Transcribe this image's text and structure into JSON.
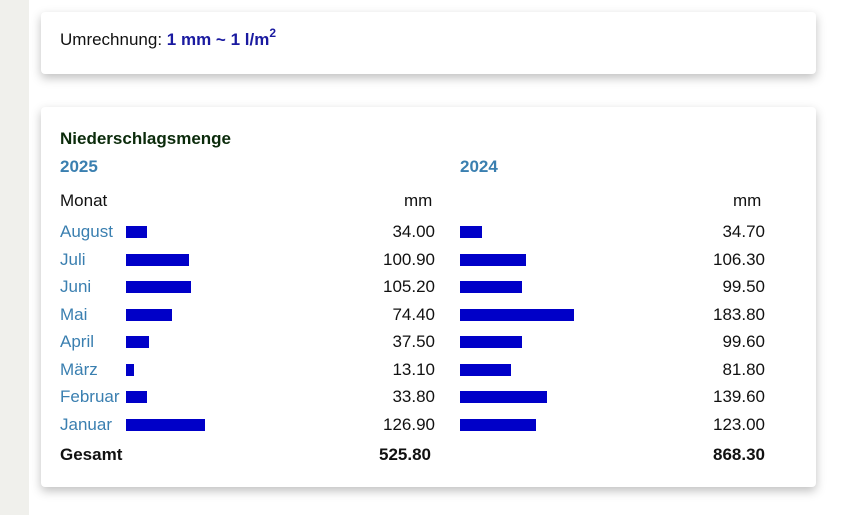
{
  "conversion": {
    "label": "Umrechnung:",
    "value": "1 mm ~ 1 l/m",
    "superscript": "2"
  },
  "precip": {
    "title": "Niederschlagsmenge",
    "col_month": "Monat",
    "unit": "mm",
    "total_label": "Gesamt",
    "bar_color": "#0000c8",
    "year_color": "#3a7fb0",
    "scale_max_mm": 183.8,
    "years": [
      {
        "year": "2025",
        "total": "525.80",
        "rows": [
          {
            "month": "August",
            "value": "34.00",
            "mm": 34.0
          },
          {
            "month": "Juli",
            "value": "100.90",
            "mm": 100.9
          },
          {
            "month": "Juni",
            "value": "105.20",
            "mm": 105.2
          },
          {
            "month": "Mai",
            "value": "74.40",
            "mm": 74.4
          },
          {
            "month": "April",
            "value": "37.50",
            "mm": 37.5
          },
          {
            "month": "März",
            "value": "13.10",
            "mm": 13.1
          },
          {
            "month": "Februar",
            "value": "33.80",
            "mm": 33.8
          },
          {
            "month": "Januar",
            "value": "126.90",
            "mm": 126.9
          }
        ]
      },
      {
        "year": "2024",
        "total": "868.30",
        "rows": [
          {
            "month": "August",
            "value": "34.70",
            "mm": 34.7
          },
          {
            "month": "Juli",
            "value": "106.30",
            "mm": 106.3
          },
          {
            "month": "Juni",
            "value": "99.50",
            "mm": 99.5
          },
          {
            "month": "Mai",
            "value": "183.80",
            "mm": 183.8
          },
          {
            "month": "April",
            "value": "99.60",
            "mm": 99.6
          },
          {
            "month": "März",
            "value": "81.80",
            "mm": 81.8
          },
          {
            "month": "Februar",
            "value": "139.60",
            "mm": 139.6
          },
          {
            "month": "Januar",
            "value": "123.00",
            "mm": 123.0
          }
        ]
      }
    ]
  }
}
